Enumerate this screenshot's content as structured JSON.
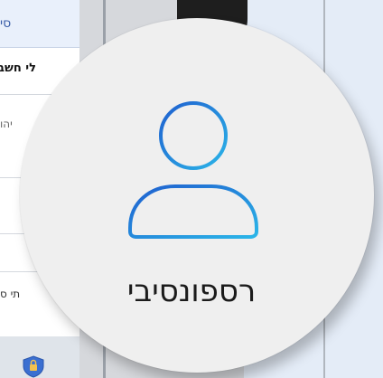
{
  "background": {
    "topbar_text": "סי",
    "row_bold_text": "לי חשב",
    "row_light_text": "יהו",
    "row_bottom_text": "תי ס"
  },
  "persona": {
    "label": "רספונסיבי",
    "icon": "user-icon"
  },
  "colors": {
    "icon_gradient_start": "#1f5fcf",
    "icon_gradient_end": "#2bb5e8",
    "circle_bg": "#efefef"
  }
}
